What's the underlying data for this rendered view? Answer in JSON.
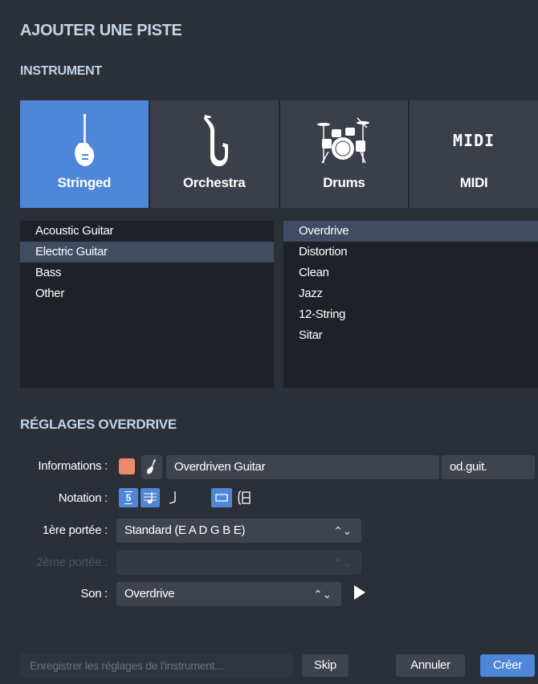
{
  "dialog": {
    "title": "AJOUTER UNE PISTE"
  },
  "instrument": {
    "section_title": "INSTRUMENT",
    "cards": [
      {
        "label": "Stringed",
        "icon": "electric-guitar-icon",
        "selected": true
      },
      {
        "label": "Orchestra",
        "icon": "saxophone-icon",
        "selected": false
      },
      {
        "label": "Drums",
        "icon": "drum-kit-icon",
        "selected": false
      },
      {
        "label": "MIDI",
        "icon": "midi-icon",
        "icon_text": "MIDI",
        "selected": false
      }
    ],
    "categories": [
      "Acoustic Guitar",
      "Electric Guitar",
      "Bass",
      "Other"
    ],
    "selected_category": "Electric Guitar",
    "presets": [
      "Overdrive",
      "Distortion",
      "Clean",
      "Jazz",
      "12-String",
      "Sitar"
    ],
    "selected_preset": "Overdrive"
  },
  "settings": {
    "section_title": "RÉGLAGES OVERDRIVE",
    "info_label": "Informations :",
    "track_color": "#ec8a69",
    "track_name": "Overdriven Guitar",
    "track_short": "od.guit.",
    "notation_label": "Notation :",
    "notation_tab_icon_text": "5",
    "staff1_label": "1ère portée :",
    "staff1_value": "Standard (E A D G B E)",
    "staff2_label": "2ème portée :",
    "staff2_value": "",
    "sound_label": "Son :",
    "sound_value": "Overdrive"
  },
  "footer": {
    "save_placeholder": "Enregistrer les réglages de l'instrument...",
    "skip_label": "Skip",
    "cancel_label": "Annuler",
    "create_label": "Créer"
  },
  "colors": {
    "accent": "#4e86d8",
    "panel": "#2b2f38",
    "list_bg": "#1e2127"
  }
}
